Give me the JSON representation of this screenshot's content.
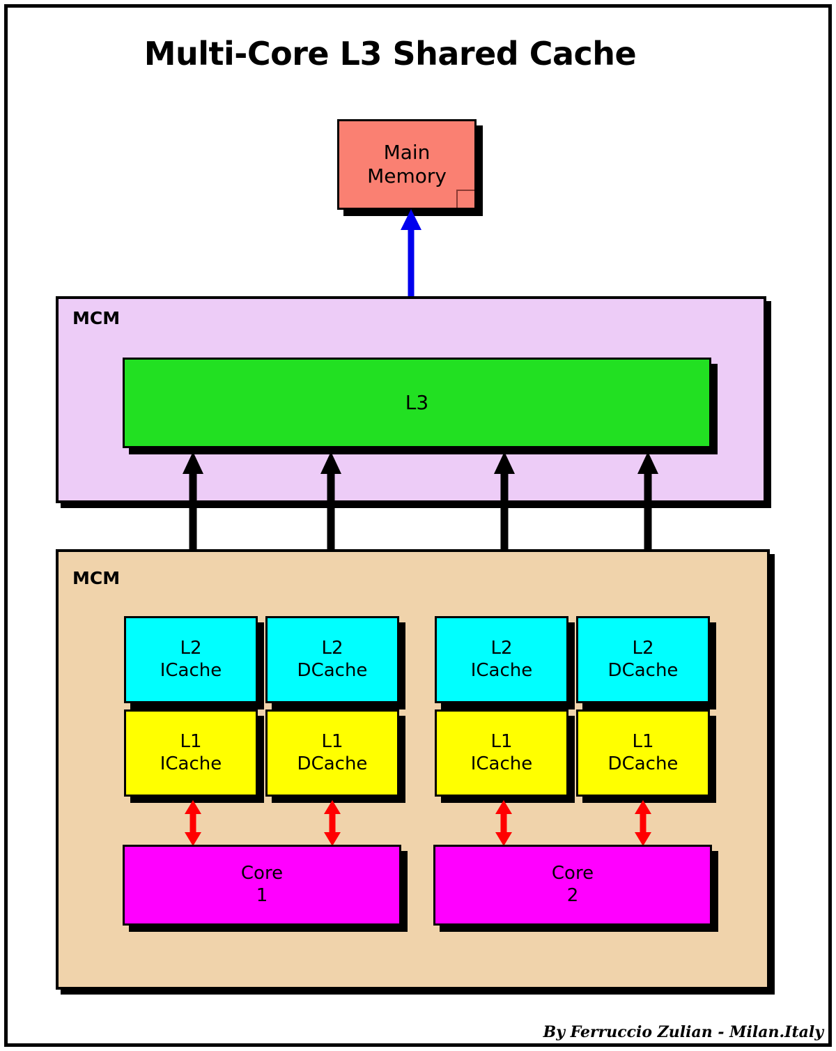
{
  "diagram": {
    "title": "Multi-Core L3 Shared Cache",
    "attribution": "By Ferruccio Zulian - Milan.Italy",
    "frame_border_color": "#000000",
    "background": "#ffffff"
  },
  "main_memory": {
    "line1": "Main",
    "line2": "Memory",
    "color": "#FA8072"
  },
  "panels": [
    {
      "label": "MCM",
      "color": "#EDCCF7"
    },
    {
      "label": "MCM",
      "color": "#F0D3AB"
    }
  ],
  "l3": {
    "label": "L3",
    "color": "#22E022"
  },
  "caches": [
    {
      "level": "L2",
      "kind": "ICache",
      "color": "#00FFFF"
    },
    {
      "level": "L2",
      "kind": "DCache",
      "color": "#00FFFF"
    },
    {
      "level": "L2",
      "kind": "ICache",
      "color": "#00FFFF"
    },
    {
      "level": "L2",
      "kind": "DCache",
      "color": "#00FFFF"
    },
    {
      "level": "L1",
      "kind": "ICache",
      "color": "#FFFF00"
    },
    {
      "level": "L1",
      "kind": "DCache",
      "color": "#FFFF00"
    },
    {
      "level": "L1",
      "kind": "ICache",
      "color": "#FFFF00"
    },
    {
      "level": "L1",
      "kind": "DCache",
      "color": "#FFFF00"
    }
  ],
  "cores": [
    {
      "line1": "Core",
      "line2": "1",
      "color": "#FF00FF"
    },
    {
      "line1": "Core",
      "line2": "2",
      "color": "#FF00FF"
    }
  ],
  "connections": {
    "memory_to_l3": {
      "color": "#0000EE",
      "style": "double-arrow"
    },
    "l3_to_l2": {
      "color": "#000000",
      "style": "double-arrow",
      "count": 4
    },
    "l1_to_core": {
      "color": "#FF0000",
      "style": "double-arrow",
      "count": 4
    }
  }
}
